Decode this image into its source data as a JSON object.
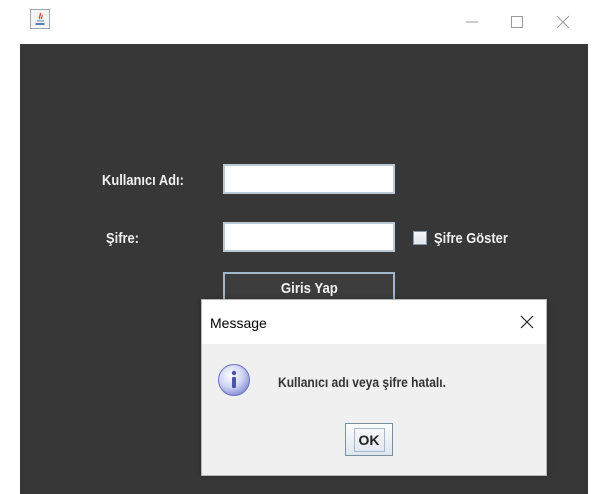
{
  "window": {
    "icon": "java-icon"
  },
  "form": {
    "username_label": "Kullanıcı Adı:",
    "username_value": "",
    "password_label": "Şifre:",
    "password_value": "",
    "show_password_label": "Şifre Göster",
    "show_password_checked": false,
    "login_button_label": "Giris Yap"
  },
  "dialog": {
    "title": "Message",
    "message": "Kullanıcı adı veya şifre hatalı.",
    "ok_label": "OK",
    "icon": "info-icon"
  },
  "colors": {
    "panel_background": "#373737",
    "label_text": "#f0f0f0",
    "dialog_background": "#f0f0f0"
  }
}
